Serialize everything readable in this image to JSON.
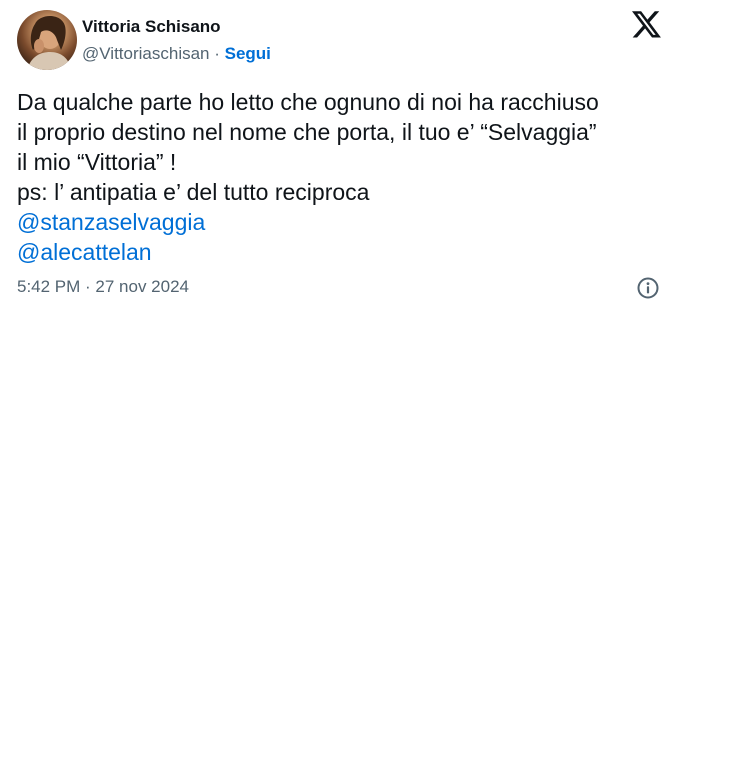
{
  "author": {
    "name": "Vittoria Schisano",
    "handle": "@Vittoriaschisan",
    "separator": " · ",
    "follow_label": "Segui",
    "avatar_icon": "profile-photo"
  },
  "brand": {
    "logo_icon": "x-logo-icon"
  },
  "tweet": {
    "lines": [
      "Da qualche parte ho letto che ognuno di noi ha racchiuso",
      "il proprio destino nel nome che porta, il tuo e’ “Selvaggia”",
      "il mio “Vittoria” !",
      "ps: l’ antipatia e’ del tutto reciproca"
    ],
    "mentions": [
      "@stanzaselvaggia",
      "@alecattelan"
    ],
    "timestamp": "5:42 PM · 27 nov 2024"
  },
  "colors": {
    "text": "#0f1419",
    "secondary": "#536471",
    "link": "#006fd6"
  }
}
